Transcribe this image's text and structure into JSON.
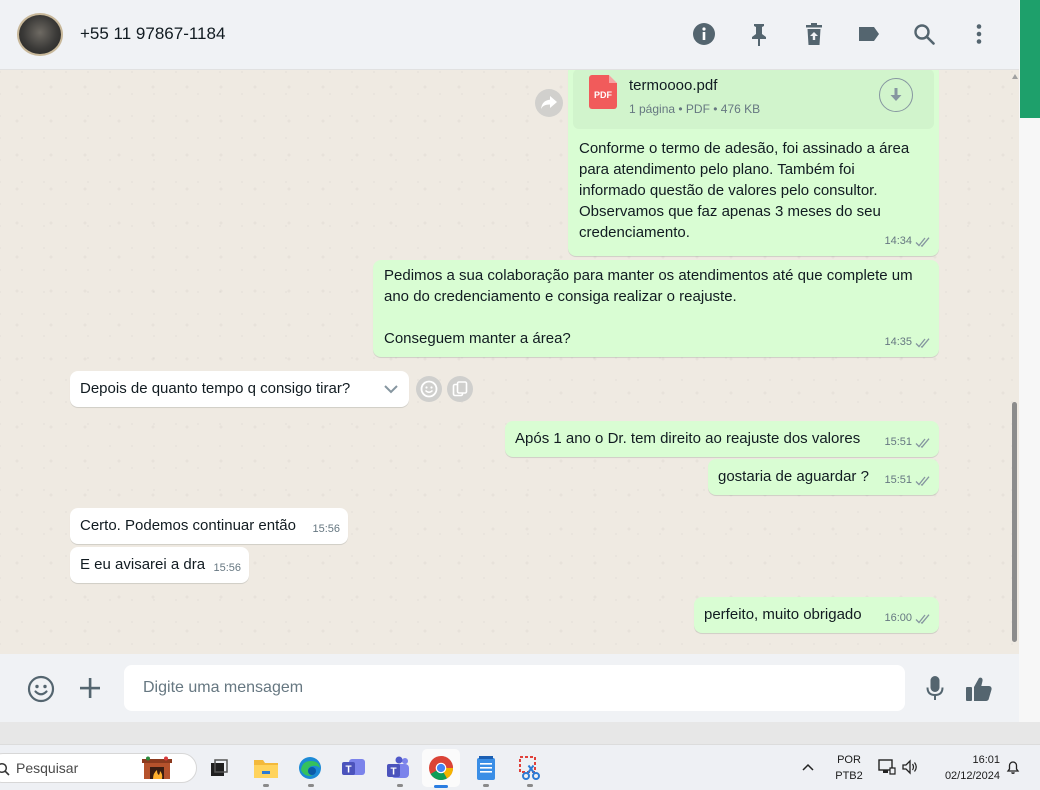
{
  "header": {
    "contact_name": "+55 11 97867-1184",
    "icons": [
      "info-icon",
      "pin-icon",
      "delete-icon",
      "label-icon",
      "search-icon",
      "more-icon"
    ]
  },
  "messages": {
    "doc": {
      "file_name": "termoooo.pdf",
      "file_info": "1 página • PDF • 476 KB",
      "pdf_badge": "PDF"
    },
    "m1": {
      "lines": [
        "Conforme o termo de adesão, foi assinado a área",
        "para atendimento pelo plano. Também foi",
        "informado questão de valores pelo consultor.",
        "Observamos que faz apenas 3 meses do seu",
        "credenciamento."
      ],
      "time": "14:34"
    },
    "m2": {
      "lines": [
        "Pedimos a sua colaboração para manter os atendimentos até que complete um",
        "ano do credenciamento e consiga realizar o reajuste.",
        "",
        "Conseguem manter a área?"
      ],
      "time": "14:35"
    },
    "m3": {
      "text": "Depois de quanto tempo q consigo tirar?"
    },
    "m4": {
      "text": "Após 1 ano o Dr. tem direito ao reajuste dos valores",
      "time": "15:51"
    },
    "m5": {
      "text": "gostaria de aguardar ?",
      "time": "15:51"
    },
    "m6": {
      "text": "Certo. Podemos continuar então",
      "time": "15:56"
    },
    "m7": {
      "text": "E eu avisarei a dra",
      "time": "15:56"
    },
    "m8": {
      "text": "perfeito, muito obrigado",
      "time": "16:00"
    }
  },
  "composer": {
    "placeholder": "Digite uma mensagem"
  },
  "taskbar": {
    "search_label": "Pesquisar",
    "language_top": "POR",
    "language_bottom": "PTB2",
    "time": "16:01",
    "date": "02/12/2024"
  },
  "colors": {
    "outgoing_bubble": "#d9fdd3",
    "incoming_bubble": "#ffffff",
    "chat_background": "#efeae2",
    "header_background": "#f0f2f5",
    "read_ticks": "#8696a0",
    "window_accent": "#1ea06b"
  }
}
